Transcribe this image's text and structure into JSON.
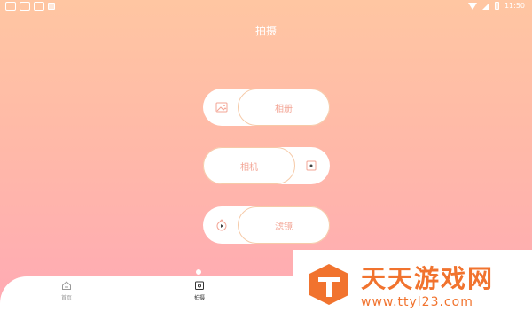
{
  "status_bar": {
    "time": "11:50",
    "left_icons": [
      "notification-icon",
      "notification-icon",
      "notification-icon",
      "app-icon"
    ],
    "right_icons": [
      "wifi-icon",
      "signal-icon",
      "battery-icon"
    ]
  },
  "header": {
    "title": "拍摄"
  },
  "actions": [
    {
      "label": "相册",
      "icon": "gallery-icon",
      "icon_side": "left"
    },
    {
      "label": "相机",
      "icon": "camera-icon",
      "icon_side": "right"
    },
    {
      "label": "滤镜",
      "icon": "filter-icon",
      "icon_side": "left"
    }
  ],
  "tabbar": {
    "items": [
      {
        "label": "首页",
        "icon": "home-icon",
        "active": false
      },
      {
        "label": "拍摄",
        "icon": "camera-tab-icon",
        "active": true
      }
    ]
  },
  "watermark": {
    "title": "天天游戏网",
    "url": "www.ttyl23.com"
  },
  "colors": {
    "gradient_top": "#ffc6a2",
    "gradient_bottom": "#ffa9b5",
    "accent": "#f3a595",
    "watermark": "#f1732e"
  }
}
